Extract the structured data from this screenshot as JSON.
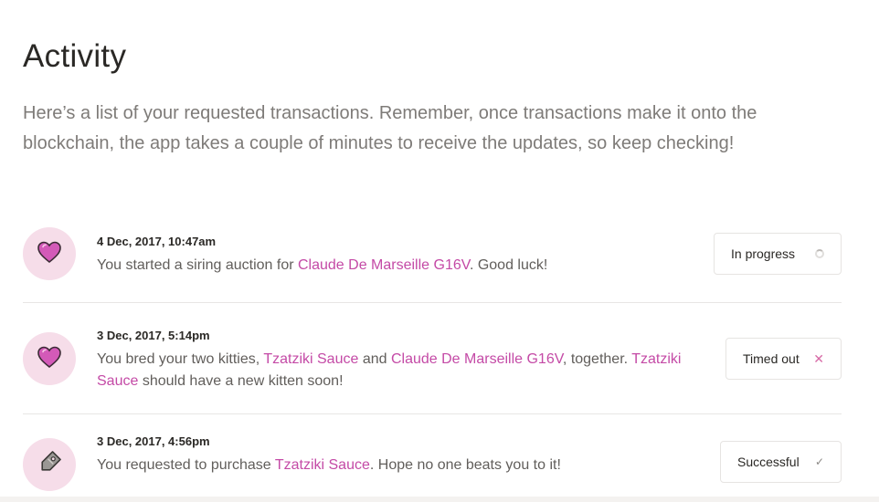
{
  "page": {
    "title": "Activity",
    "intro": "Here’s a list of your requested transactions. Remember, once transactions make it onto the blockchain, the app takes a couple of minutes to receive the updates, so keep checking!"
  },
  "activities": [
    {
      "timestamp": "4 Dec, 2017, 10:47am",
      "parts": [
        "You started a siring auction for ",
        "Claude De Marseille G16V",
        ". Good luck!"
      ],
      "status": "In progress",
      "icon": "heart-icon",
      "status_icon": "spinner-icon"
    },
    {
      "timestamp": "3 Dec, 2017, 5:14pm",
      "parts": [
        "You bred your two kitties, ",
        "Tzatziki Sauce",
        " and ",
        "Claude De Marseille G16V",
        ", together. ",
        "Tzatziki Sauce",
        " should have a new kitten soon!"
      ],
      "status": "Timed out",
      "icon": "heart-icon",
      "status_icon": "x-icon",
      "status_icon_glyph": "✕"
    },
    {
      "timestamp": "3 Dec, 2017, 4:56pm",
      "parts": [
        "You requested to purchase ",
        "Tzatziki Sauce",
        ". Hope no one beats you to it!"
      ],
      "status": "Successful",
      "icon": "price-tag-icon",
      "status_icon": "check-icon",
      "status_icon_glyph": "✓"
    }
  ],
  "colors": {
    "kitty_link": "#c44aa6",
    "avatar_bg": "#f6dde9",
    "heart": "#d35ab8"
  }
}
